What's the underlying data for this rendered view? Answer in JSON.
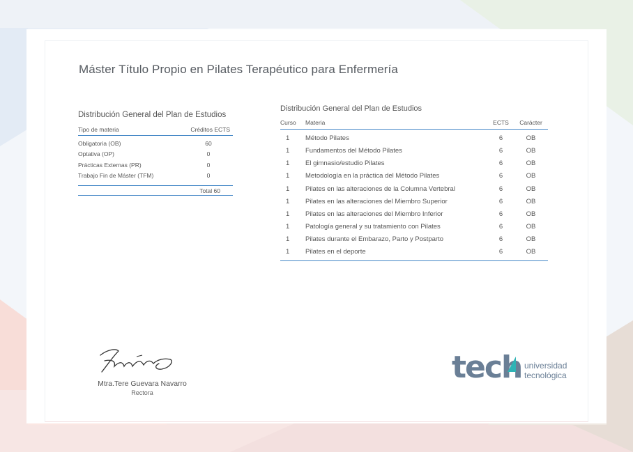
{
  "title": "Máster Título Propio en Pilates Terapéutico para Enfermería",
  "summary": {
    "heading": "Distribución General del Plan de Estudios",
    "col_type": "Tipo de materia",
    "col_credits": "Créditos ECTS",
    "rows": [
      {
        "name": "Obligatoria (OB)",
        "value": "60"
      },
      {
        "name": "Optativa (OP)",
        "value": "0"
      },
      {
        "name": "Prácticas Externas (PR)",
        "value": "0"
      },
      {
        "name": "Trabajo Fin de Máster (TFM)",
        "value": "0"
      }
    ],
    "total": "Total 60"
  },
  "plan": {
    "heading": "Distribución General del Plan de Estudios",
    "headers": {
      "curso": "Curso",
      "materia": "Materia",
      "ects": "ECTS",
      "caracter": "Carácter"
    },
    "rows": [
      {
        "curso": "1",
        "materia": "Método Pilates",
        "ects": "6",
        "caracter": "OB"
      },
      {
        "curso": "1",
        "materia": "Fundamentos del Método Pilates",
        "ects": "6",
        "caracter": "OB"
      },
      {
        "curso": "1",
        "materia": "El gimnasio/estudio Pilates",
        "ects": "6",
        "caracter": "OB"
      },
      {
        "curso": "1",
        "materia": "Metodología en la práctica del Método Pilates",
        "ects": "6",
        "caracter": "OB"
      },
      {
        "curso": "1",
        "materia": "Pilates en las alteraciones de la Columna Vertebral",
        "ects": "6",
        "caracter": "OB"
      },
      {
        "curso": "1",
        "materia": "Pilates en las alteraciones del Miembro Superior",
        "ects": "6",
        "caracter": "OB"
      },
      {
        "curso": "1",
        "materia": "Pilates en las alteraciones del Miembro Inferior",
        "ects": "6",
        "caracter": "OB"
      },
      {
        "curso": "1",
        "materia": "Patología general y su tratamiento con Pilates",
        "ects": "6",
        "caracter": "OB"
      },
      {
        "curso": "1",
        "materia": "Pilates durante el Embarazo, Parto y Postparto",
        "ects": "6",
        "caracter": "OB"
      },
      {
        "curso": "1",
        "materia": "Pilates en el deporte",
        "ects": "6",
        "caracter": "OB"
      }
    ]
  },
  "signer": {
    "name": "Mtra.Tere Guevara Navarro",
    "role": "Rectora"
  },
  "logo": {
    "word": "tech",
    "line1": "universidad",
    "line2": "tecnológica",
    "text_color": "#6a7f96",
    "accent_color": "#2fb3b5"
  },
  "colors": {
    "rule": "#3f84c5",
    "background_tint_blue": "#dde7f3",
    "background_tint_pink": "#f6d5d0",
    "background_tint_green": "#e5efe2"
  }
}
